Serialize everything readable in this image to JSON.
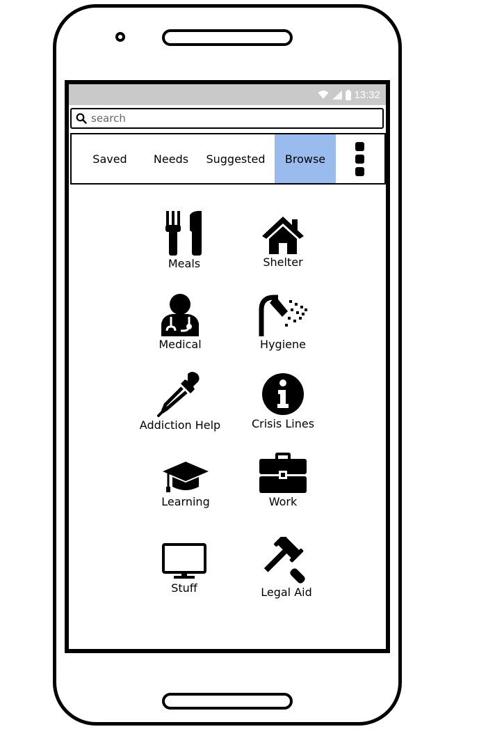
{
  "status_bar": {
    "time": "13:32",
    "icons": [
      "wifi-icon",
      "signal-icon",
      "battery-icon"
    ]
  },
  "search": {
    "placeholder": "search",
    "value": ""
  },
  "tabs": [
    {
      "label": "Saved",
      "active": false
    },
    {
      "label": "Needs",
      "active": false
    },
    {
      "label": "Suggested",
      "active": false
    },
    {
      "label": "Browse",
      "active": true
    }
  ],
  "more_menu": {
    "icon": "more-vertical-icon"
  },
  "categories": [
    {
      "label": "Meals",
      "icon": "utensils-icon"
    },
    {
      "label": "Shelter",
      "icon": "home-icon"
    },
    {
      "label": "Medical",
      "icon": "doctor-icon"
    },
    {
      "label": "Hygiene",
      "icon": "shower-icon"
    },
    {
      "label": "Addiction Help",
      "icon": "eyedropper-icon"
    },
    {
      "label": "Crisis Lines",
      "icon": "info-icon"
    },
    {
      "label": "Learning",
      "icon": "graduation-cap-icon"
    },
    {
      "label": "Work",
      "icon": "briefcase-icon"
    },
    {
      "label": "Stuff",
      "icon": "monitor-icon"
    },
    {
      "label": "Legal Aid",
      "icon": "gavel-icon"
    }
  ],
  "colors": {
    "active_tab": "#99bbee",
    "status_bar": "#c9c9c9"
  }
}
